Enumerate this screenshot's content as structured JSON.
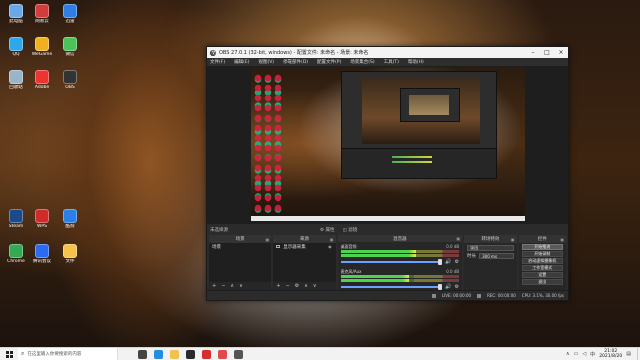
{
  "desktop": {
    "icons": [
      {
        "label": "此电脑",
        "color": "#6aa8e8"
      },
      {
        "label": "网易云",
        "color": "#d23c3c"
      },
      {
        "label": "迅雷",
        "color": "#2f7ee6"
      },
      {
        "label": "QQ",
        "color": "#2da8ea"
      },
      {
        "label": "WeGame",
        "color": "#f0b020"
      },
      {
        "label": "微信",
        "color": "#4cc35a"
      },
      {
        "label": "回收站",
        "color": "#9ab4c8"
      },
      {
        "label": "Adobe",
        "color": "#e33"
      },
      {
        "label": "OBS",
        "color": "#333"
      },
      {
        "label": "Steam",
        "color": "#1a4a8a"
      },
      {
        "label": "WPS",
        "color": "#d02b2b"
      },
      {
        "label": "酷狗",
        "color": "#2a7fe8"
      },
      {
        "label": "Chrome",
        "color": "#34a853"
      },
      {
        "label": "腾讯会议",
        "color": "#2a6bf2"
      },
      {
        "label": "文件",
        "color": "#f5c24b"
      }
    ]
  },
  "obs": {
    "title": "OBS 27.0.1 (32-bit, windows) - 配置文件: 未命名 - 场景: 未命名",
    "menu": [
      "文件(F)",
      "编辑(E)",
      "视图(V)",
      "停靠部件(D)",
      "配置文件(P)",
      "场景集合(S)",
      "工具(T)",
      "帮助(H)"
    ],
    "source_toolbar": {
      "no_selection": "未选择源",
      "properties": "属性",
      "filters": "滤镜"
    },
    "docks": {
      "scenes": {
        "title": "场景",
        "items": [
          "场景"
        ]
      },
      "sources": {
        "title": "来源",
        "items": [
          {
            "name": "显示器采集"
          }
        ]
      },
      "mixer": {
        "title": "混音器",
        "channels": [
          {
            "name": "桌面音频",
            "db": "0.0 dB",
            "level_percent": 64,
            "volume_percent": 100
          },
          {
            "name": "麦克风/Aux",
            "db": "0.0 dB",
            "level_percent": 58,
            "volume_percent": 100
          }
        ]
      },
      "transitions": {
        "title": "转场特效",
        "type": "淡出",
        "duration_label": "时长",
        "duration_value": "300 ms"
      },
      "controls": {
        "title": "控件",
        "buttons": [
          "开始推流",
          "开始录制",
          "启动虚拟摄像机",
          "工作室模式",
          "设置",
          "退出"
        ],
        "hovered": 0
      }
    },
    "status": {
      "live": "LIVE: 00:00:00",
      "rec": "REC: 00:00:00",
      "cpu": "CPU: 3.1%, 30.00 fps"
    }
  },
  "taskbar": {
    "search_placeholder": "在这里输入你要搜索的内容",
    "apps": [
      {
        "name": "task-view-icon",
        "color": "#444"
      },
      {
        "name": "edge-icon",
        "color": "#1f8fe0"
      },
      {
        "name": "explorer-icon",
        "color": "#f2c14e"
      },
      {
        "name": "obs-icon",
        "color": "#2a2a2a"
      },
      {
        "name": "netease-music-icon",
        "color": "#d92c2c"
      },
      {
        "name": "media-icon",
        "color": "#e14a4a"
      },
      {
        "name": "app-icon",
        "color": "#555"
      }
    ],
    "time": "21:02",
    "date": "2021/8/20"
  }
}
